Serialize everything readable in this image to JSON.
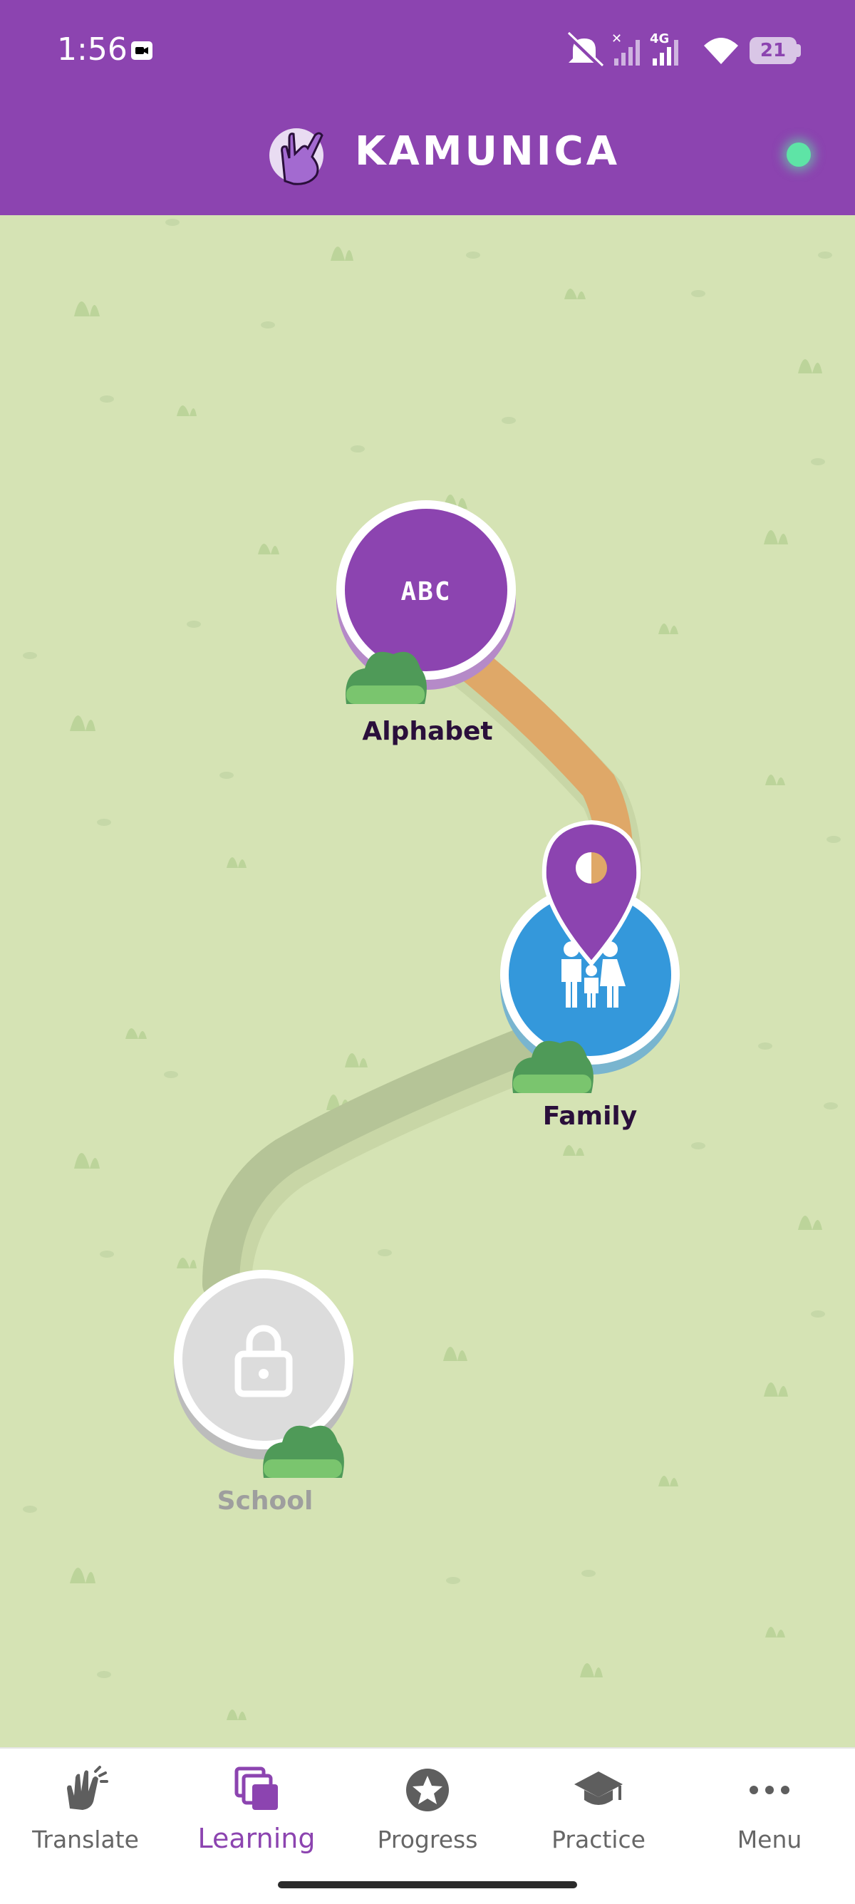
{
  "status_bar": {
    "time": "1:56",
    "battery": "21",
    "network": "4G"
  },
  "header": {
    "title": "KAMUNICA",
    "logo_icon": "hand-sign-logo-icon",
    "online_indicator_color": "#5ee4a6"
  },
  "map": {
    "nodes": [
      {
        "label": "Alphabet",
        "icon_text": "ABC",
        "state": "completed",
        "color": "#8c44b0"
      },
      {
        "label": "Family",
        "icon": "family-icon",
        "state": "current",
        "color": "#3498db"
      },
      {
        "label": "School",
        "icon": "lock-icon",
        "state": "locked",
        "color": "#dcdcdc"
      }
    ],
    "current_marker_icon": "location-pin-icon"
  },
  "nav": {
    "items": [
      {
        "label": "Translate",
        "icon": "sign-hand-icon",
        "active": false
      },
      {
        "label": "Learning",
        "icon": "cards-icon",
        "active": true
      },
      {
        "label": "Progress",
        "icon": "star-badge-icon",
        "active": false
      },
      {
        "label": "Practice",
        "icon": "graduation-cap-icon",
        "active": false
      },
      {
        "label": "Menu",
        "icon": "more-dots-icon",
        "active": false
      }
    ]
  },
  "colors": {
    "brand": "#8c44b0",
    "map_background": "#d5e3b4",
    "completed_path": "#dfa868",
    "locked_path": "#b5c497"
  }
}
